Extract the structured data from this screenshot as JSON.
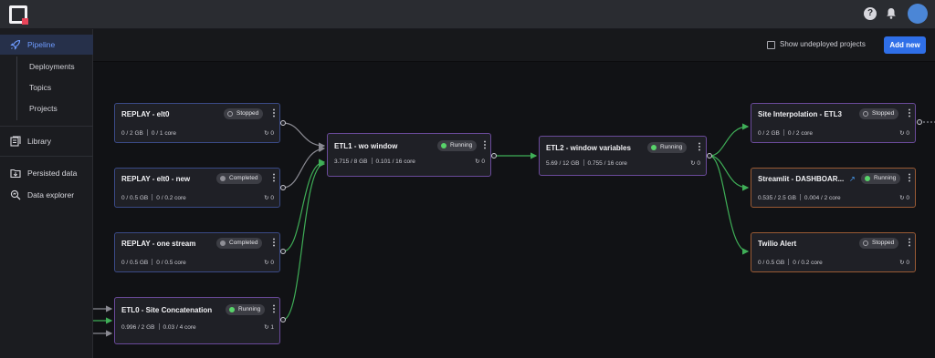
{
  "icons": {
    "logo": "logo-icon",
    "help": "help-icon",
    "notifications": "bell-icon",
    "pipeline": "rocket-icon",
    "library": "library-icon",
    "persisted": "persisted-data-icon",
    "explorer": "data-explorer-icon",
    "restart": "restart-icon",
    "more": "kebab-icon",
    "external": "external-link-icon"
  },
  "topbar": {
    "help_glyph": "?"
  },
  "sidebar": {
    "pipeline": "Pipeline",
    "sub_items": [
      "Deployments",
      "Topics",
      "Projects"
    ],
    "library": "Library",
    "persisted_data": "Persisted data",
    "data_explorer": "Data explorer"
  },
  "toolbar": {
    "show_undeployed_label": "Show undeployed projects",
    "add_new_label": "Add new"
  },
  "colors": {
    "accent": "#2f6fe8",
    "running": "#58d36a",
    "edge_active": "#3fae57",
    "edge_inactive": "#8a8a92"
  },
  "nodes": [
    {
      "title": "REPLAY - elt0",
      "status": "Stopped",
      "memory": "0 / 2 GB",
      "cpu": "0 / 1 core",
      "restarts": "0"
    },
    {
      "title": "REPLAY - elt0 - new",
      "status": "Completed",
      "memory": "0 / 0.5 GB",
      "cpu": "0 / 0.2 core",
      "restarts": "0"
    },
    {
      "title": "REPLAY - one stream",
      "status": "Completed",
      "memory": "0 / 0.5 GB",
      "cpu": "0 / 0.5 core",
      "restarts": "0"
    },
    {
      "title": "ETL0 - Site Concatenation",
      "status": "Running",
      "memory": "0.996 / 2 GB",
      "cpu": "0.03 / 4 core",
      "restarts": "1"
    },
    {
      "title": "ETL1 - wo window",
      "status": "Running",
      "memory": "3.715 / 8 GB",
      "cpu": "0.101 / 16 core",
      "restarts": "0"
    },
    {
      "title": "ETL2 - window variables",
      "status": "Running",
      "memory": "5.69 / 12 GB",
      "cpu": "0.755 / 16 core",
      "restarts": "0"
    },
    {
      "title": "Site Interpolation - ETL3",
      "status": "Stopped",
      "memory": "0 / 2 GB",
      "cpu": "0 / 2 core",
      "restarts": "0"
    },
    {
      "title": "Streamlit - DASHBOAR...",
      "status": "Running",
      "memory": "0.535 / 2.5 GB",
      "cpu": "0.004 / 2 core",
      "restarts": "0"
    },
    {
      "title": "Twilio Alert",
      "status": "Stopped",
      "memory": "0 / 0.5 GB",
      "cpu": "0 / 0.2 core",
      "restarts": "0"
    }
  ]
}
